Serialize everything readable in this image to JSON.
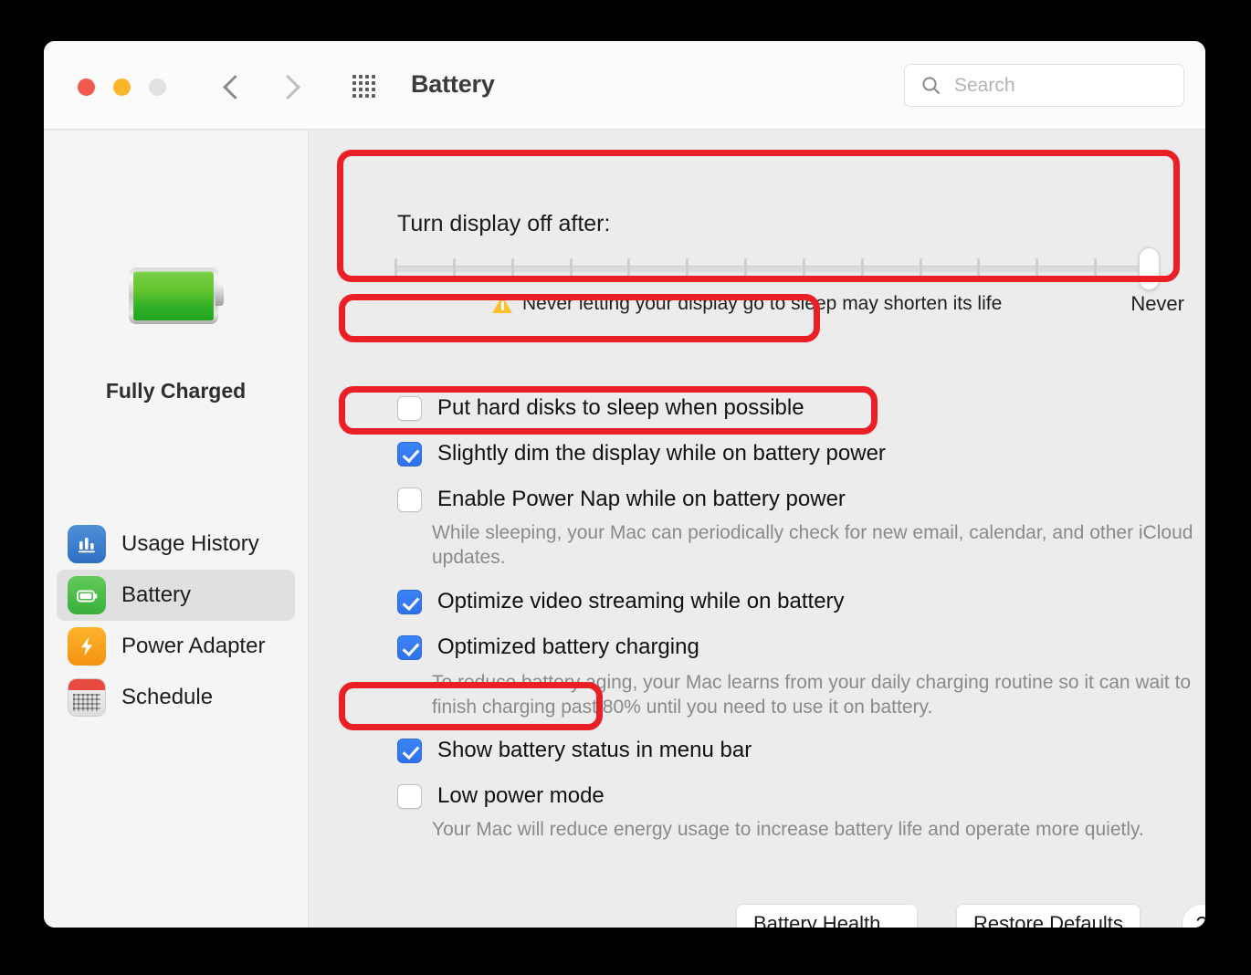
{
  "window": {
    "title": "Battery",
    "traffic_lights": [
      "close",
      "minimize",
      "zoom"
    ],
    "nav_back_icon": "chevron-left-icon",
    "nav_forward_icon": "chevron-right-icon",
    "grid_icon": "all-preferences-grid-icon"
  },
  "search": {
    "placeholder": "Search",
    "value": "",
    "icon": "search-icon"
  },
  "sidebar": {
    "battery_icon": "battery-full-icon",
    "charge_status": "Fully Charged",
    "items": [
      {
        "label": "Usage History",
        "icon": "usage-history-icon",
        "selected": false
      },
      {
        "label": "Battery",
        "icon": "battery-icon",
        "selected": true
      },
      {
        "label": "Power Adapter",
        "icon": "power-adapter-bolt-icon",
        "selected": false
      },
      {
        "label": "Schedule",
        "icon": "schedule-calendar-icon",
        "selected": false
      }
    ]
  },
  "main": {
    "display_off_label": "Turn display off after:",
    "slider": {
      "value_label": "Never",
      "position_percent": 100,
      "tick_count": 14,
      "warning_icon": "warning-triangle-icon",
      "warning_text": "Never letting your display go to sleep may shorten its life"
    },
    "checkboxes": [
      {
        "label": "Put hard disks to sleep when possible",
        "checked": false
      },
      {
        "label": "Slightly dim the display while on battery power",
        "checked": true
      },
      {
        "label": "Enable Power Nap while on battery power",
        "checked": false
      },
      {
        "label": "Optimize video streaming while on battery",
        "checked": true
      },
      {
        "label": "Optimized battery charging",
        "checked": true
      },
      {
        "label": "Show battery status in menu bar",
        "checked": true
      },
      {
        "label": "Low power mode",
        "checked": false
      }
    ],
    "descriptions": {
      "power_nap": "While sleeping, your Mac can periodically check for new email, calendar, and other iCloud updates.",
      "optimized_charging": "To reduce battery aging, your Mac learns from your daily charging routine so it can wait to finish charging past 80% until you need to use it on battery.",
      "low_power_mode": "Your Mac will reduce energy usage to increase battery life and operate more quietly."
    },
    "buttons": {
      "battery_health": "Battery Health…",
      "restore_defaults": "Restore Defaults",
      "help": "?"
    }
  },
  "annotations": {
    "color": "#ea2026",
    "count": 4,
    "targets": [
      "turn-display-off-section",
      "put-hard-disks-to-sleep-checkbox",
      "enable-power-nap-checkbox",
      "low-power-mode-checkbox"
    ]
  }
}
